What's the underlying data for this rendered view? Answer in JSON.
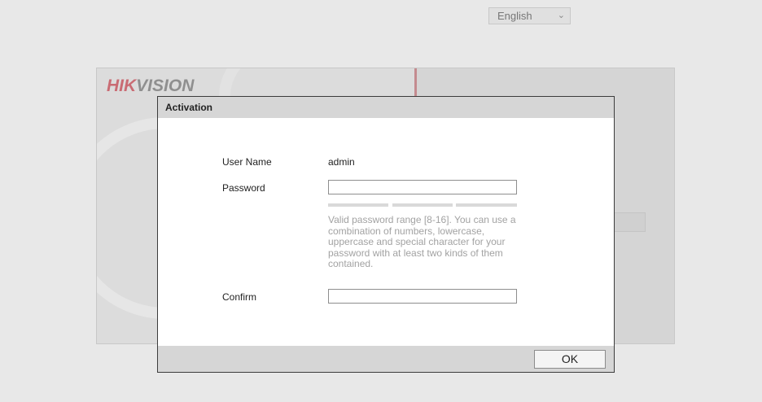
{
  "background": {
    "logo_hik": "HIK",
    "logo_vision": "VISION",
    "language_select": {
      "value": "English"
    }
  },
  "dialog": {
    "title": "Activation",
    "username": {
      "label": "User Name",
      "value": "admin"
    },
    "password": {
      "label": "Password",
      "value": "",
      "strength_segments": 3
    },
    "hint": "Valid password range [8-16]. You can use a combination of numbers, lowercase, uppercase and special character for your password with at least two kinds of them contained.",
    "confirm": {
      "label": "Confirm",
      "value": ""
    },
    "ok_label": "OK"
  },
  "colors": {
    "brand_red": "#c96b73",
    "header_gray": "#d6d6d6",
    "hint_gray": "#a2a2a2"
  }
}
